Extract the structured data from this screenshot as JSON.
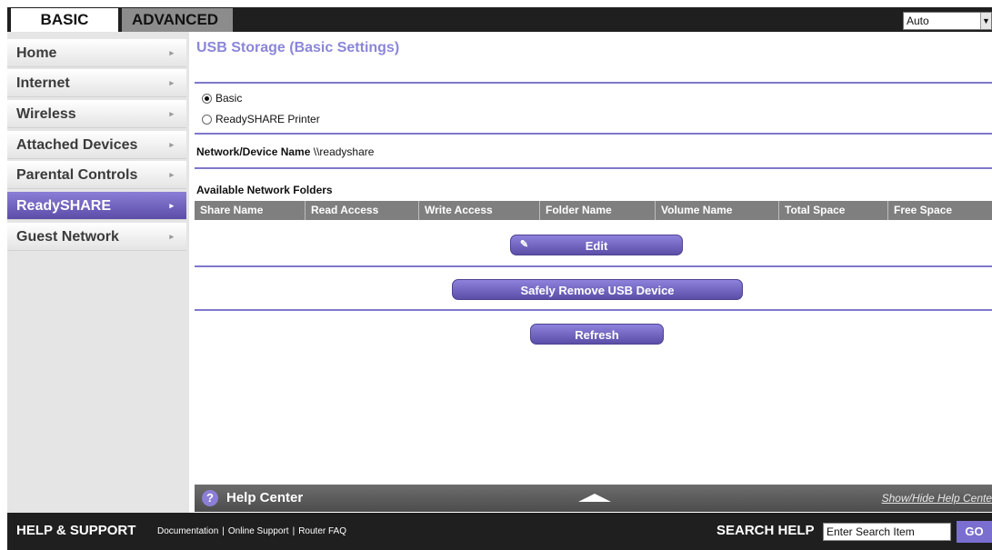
{
  "tabs": {
    "basic": "BASIC",
    "advanced": "ADVANCED"
  },
  "language": {
    "value": "Auto",
    "arrow": "▼"
  },
  "sidebar": {
    "items": [
      {
        "label": "Home"
      },
      {
        "label": "Internet"
      },
      {
        "label": "Wireless"
      },
      {
        "label": "Attached Devices"
      },
      {
        "label": "Parental Controls"
      },
      {
        "label": "ReadySHARE",
        "active": true
      },
      {
        "label": "Guest Network"
      }
    ],
    "chevron": "▸"
  },
  "main": {
    "title": "USB Storage (Basic Settings)",
    "radios": {
      "basic": "Basic",
      "printer": "ReadySHARE Printer",
      "selected": "Basic"
    },
    "device_name_label": "Network/Device Name",
    "device_name_value": "\\\\readyshare",
    "folders_label": "Available Network Folders",
    "table_columns": [
      "Share Name",
      "Read Access",
      "Write Access",
      "Folder Name",
      "Volume Name",
      "Total Space",
      "Free Space"
    ],
    "edit_button": "Edit",
    "remove_button": "Safely Remove USB Device",
    "refresh_button": "Refresh"
  },
  "help_center": {
    "title": "Help Center",
    "toggle_link": "Show/Hide Help Cente",
    "icon": "?"
  },
  "footer": {
    "title": "HELP & SUPPORT",
    "links": [
      "Documentation",
      "Online Support",
      "Router FAQ"
    ],
    "search_label": "SEARCH HELP",
    "search_value": "Enter Search Item",
    "go_label": "GO"
  },
  "colors": {
    "accent": "#8b86d9",
    "active_menu": "#6e62c2",
    "dark_bar": "#1f1f1f"
  }
}
